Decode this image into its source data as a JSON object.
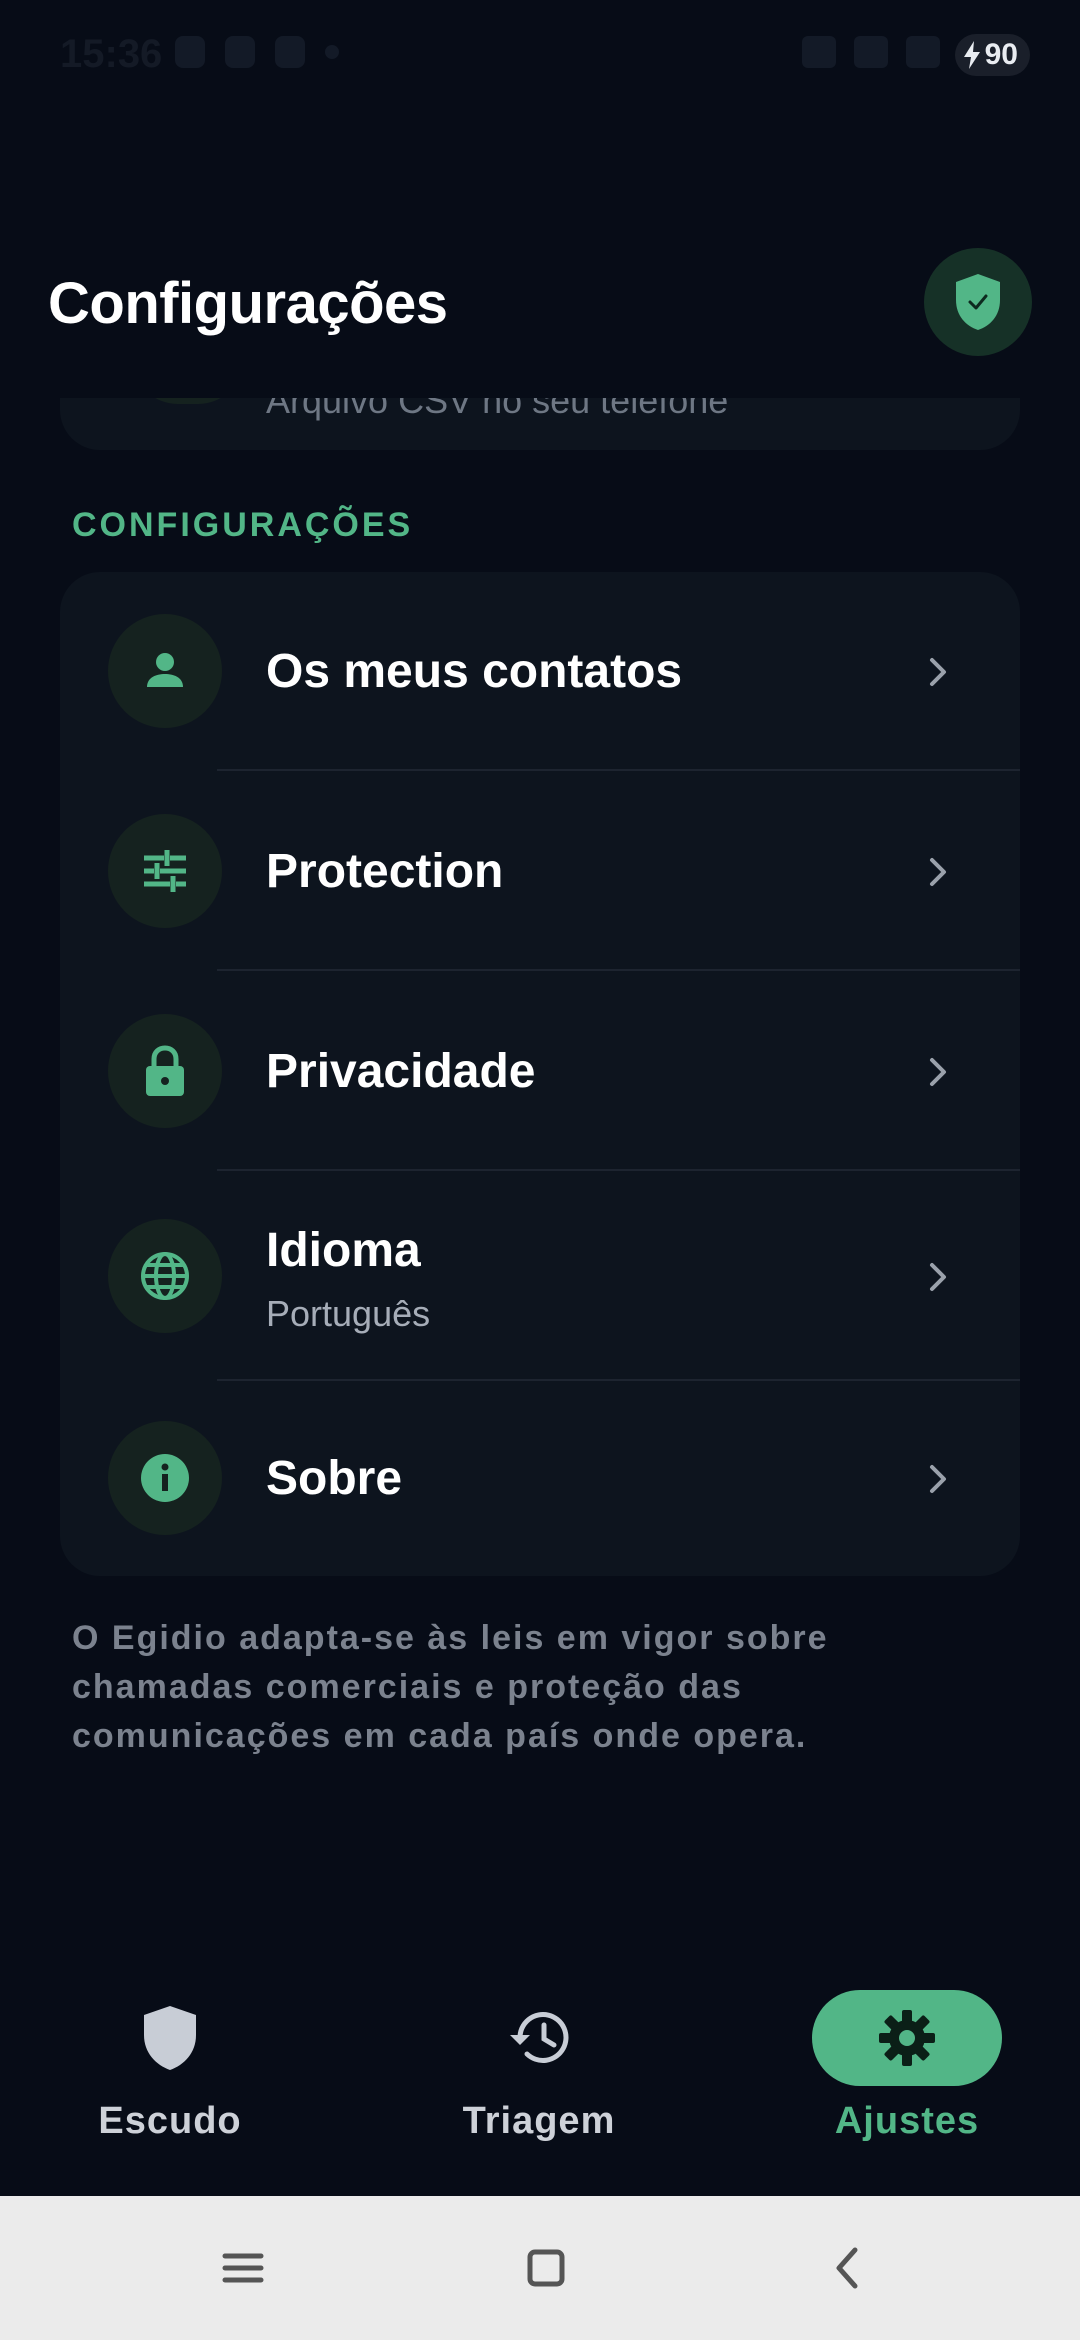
{
  "status_bar": {
    "time": "15:36",
    "battery": "90"
  },
  "header": {
    "title": "Configurações"
  },
  "previous_card": {
    "subtitle_partial": "Arquivo CSV no seu telefone"
  },
  "settings": {
    "section_label": "CONFIGURAÇÕES",
    "items": [
      {
        "title": "Os meus contatos",
        "icon": "person-icon"
      },
      {
        "title": "Protection",
        "icon": "sliders-icon"
      },
      {
        "title": "Privacidade",
        "icon": "lock-icon"
      },
      {
        "title": "Idioma",
        "subtitle": "Português",
        "icon": "globe-icon"
      },
      {
        "title": "Sobre",
        "icon": "info-icon"
      }
    ]
  },
  "footnote": "O Egidio adapta-se às leis em vigor sobre chamadas comerciais e proteção das comunicações em cada país onde opera.",
  "bottom_nav": {
    "items": [
      {
        "label": "Escudo",
        "icon": "shield-icon",
        "active": false
      },
      {
        "label": "Triagem",
        "icon": "history-icon",
        "active": false
      },
      {
        "label": "Ajustes",
        "icon": "gear-icon",
        "active": true
      }
    ]
  },
  "colors": {
    "background": "#070c17",
    "card": "#0d141e",
    "accent": "#52b687",
    "icon_bg": "#15221f"
  }
}
